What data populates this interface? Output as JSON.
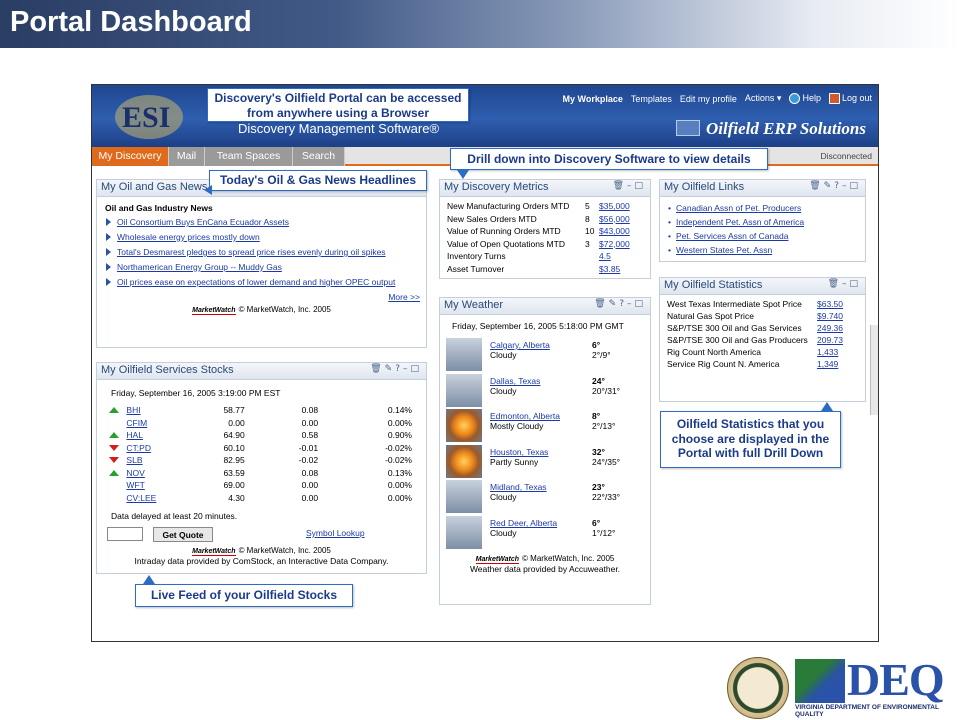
{
  "slide": {
    "title": "Portal Dashboard"
  },
  "portal": {
    "software_title": "Discovery Management Software®",
    "erp_title": "Oilfield ERP Solutions",
    "logo_text": "ESI",
    "nav": {
      "workplace": "My Workplace",
      "templates": "Templates",
      "edit_profile": "Edit my profile",
      "actions": "Actions ▾",
      "help": "Help",
      "logout": "Log out"
    },
    "tabs": [
      "My Discovery",
      "Mail",
      "Team Spaces",
      "Search"
    ],
    "status": "Disconnected"
  },
  "news": {
    "title": "My Oil and Gas News",
    "section": "Oil and Gas Industry News",
    "items": [
      "Oil Consortium Buys EnCana Ecuador Assets",
      "Wholesale energy prices mostly down",
      "Total's Desmarest pledges to spread price rises evenly during oil spikes",
      "Northamerican Energy Group -- Muddy Gas",
      "Oil prices ease on expectations of lower demand and higher OPEC output"
    ],
    "more": "More >>",
    "credit": "© MarketWatch, Inc. 2005"
  },
  "stocks": {
    "title": "My Oilfield Services Stocks",
    "timestamp": "Friday, September 16, 2005 3:19:00 PM EST",
    "rows": [
      {
        "trend": "up",
        "symbol": "BHI",
        "price": "58.77",
        "change": "0.08",
        "pct": "0.14%"
      },
      {
        "trend": "flat",
        "symbol": "CFIM",
        "price": "0.00",
        "change": "0.00",
        "pct": "0.00%"
      },
      {
        "trend": "up",
        "symbol": "HAL",
        "price": "64.90",
        "change": "0.58",
        "pct": "0.90%"
      },
      {
        "trend": "down",
        "symbol": "CT:PD",
        "price": "60.10",
        "change": "-0.01",
        "pct": "-0.02%"
      },
      {
        "trend": "down",
        "symbol": "SLB",
        "price": "82.95",
        "change": "-0.02",
        "pct": "-0.02%"
      },
      {
        "trend": "up",
        "symbol": "NOV",
        "price": "63.59",
        "change": "0.08",
        "pct": "0.13%"
      },
      {
        "trend": "flat",
        "symbol": "WFT",
        "price": "69.00",
        "change": "0.00",
        "pct": "0.00%"
      },
      {
        "trend": "flat",
        "symbol": "CV:LEE",
        "price": "4.30",
        "change": "0.00",
        "pct": "0.00%"
      }
    ],
    "delay_note": "Data delayed at least 20 minutes.",
    "quote_button": "Get Quote",
    "symbol_lookup": "Symbol Lookup",
    "credit": "© MarketWatch, Inc. 2005",
    "provider": "Intraday data provided by ComStock, an Interactive Data Company."
  },
  "metrics": {
    "title": "My Discovery Metrics",
    "rows": [
      {
        "label": "New Manufacturing Orders MTD",
        "count": "5",
        "value": "$35,000"
      },
      {
        "label": "New Sales Orders MTD",
        "count": "8",
        "value": "$56,000"
      },
      {
        "label": "Value of Running Orders MTD",
        "count": "10",
        "value": "$43,000"
      },
      {
        "label": "Value of Open Quotations MTD",
        "count": "3",
        "value": "$72,000"
      },
      {
        "label": "Inventory Turns",
        "count": "",
        "value": "4.5"
      },
      {
        "label": "Asset Turnover",
        "count": "",
        "value": "$3.85"
      }
    ]
  },
  "weather": {
    "title": "My Weather",
    "timestamp": "Friday, September 16, 2005 5:18:00 PM GMT",
    "rows": [
      {
        "city": "Calgary, Alberta",
        "cond": "Cloudy",
        "temp": "6°",
        "range": "2°/9°",
        "icon": "cloud-icon"
      },
      {
        "city": "Dallas, Texas",
        "cond": "Cloudy",
        "temp": "24°",
        "range": "20°/31°",
        "icon": "cloud-icon"
      },
      {
        "city": "Edmonton, Alberta",
        "cond": "Mostly Cloudy",
        "temp": "8°",
        "range": "2°/13°",
        "icon": "sun-cloud-icon"
      },
      {
        "city": "Houston, Texas",
        "cond": "Partly Sunny",
        "temp": "32°",
        "range": "24°/35°",
        "icon": "sun-icon"
      },
      {
        "city": "Midland, Texas",
        "cond": "Cloudy",
        "temp": "23°",
        "range": "22°/33°",
        "icon": "cloud-icon"
      },
      {
        "city": "Red Deer, Alberta",
        "cond": "Cloudy",
        "temp": "6°",
        "range": "1°/12°",
        "icon": "cloud-icon"
      }
    ],
    "credit": "© MarketWatch, Inc. 2005",
    "provider": "Weather data provided by Accuweather."
  },
  "links": {
    "title": "My Oilfield Links",
    "items": [
      "Canadian Assn of Pet. Producers",
      "Independent Pet. Assn of America",
      "Pet. Services Assn of Canada",
      "Western States Pet. Assn"
    ]
  },
  "statistics": {
    "title": "My Oilfield Statistics",
    "rows": [
      {
        "label": "West Texas Intermediate Spot Price",
        "value": "$63.50"
      },
      {
        "label": "Natural Gas Spot Price",
        "value": "$9.740"
      },
      {
        "label": "S&P/TSE 300 Oil and Gas Services",
        "value": "249.36"
      },
      {
        "label": "S&P/TSE 300 Oil and Gas Producers",
        "value": "209.73"
      },
      {
        "label": "Rig Count North America",
        "value": "1,433"
      },
      {
        "label": "Service Rig Count N. America",
        "value": "1,349"
      }
    ]
  },
  "callouts": {
    "browser": "Discovery's Oilfield Portal can be accessed from anywhere using a Browser",
    "drill": "Drill down into Discovery Software to view details",
    "news": "Today's Oil & Gas News Headlines",
    "stats": "Oilfield Statistics that you choose are displayed in the Portal with full Drill Down",
    "stocks": "Live Feed of your Oilfield Stocks"
  },
  "footer": {
    "deq": "DEQ",
    "deq_sub": "VIRGINIA DEPARTMENT OF ENVIRONMENTAL QUALITY",
    "marketwatch": "MarketWatch"
  },
  "colors": {
    "accent": "#e06a1c",
    "banner": "#2f5fb0",
    "link": "#1c3aa6",
    "callout": "#2c6cc4"
  }
}
